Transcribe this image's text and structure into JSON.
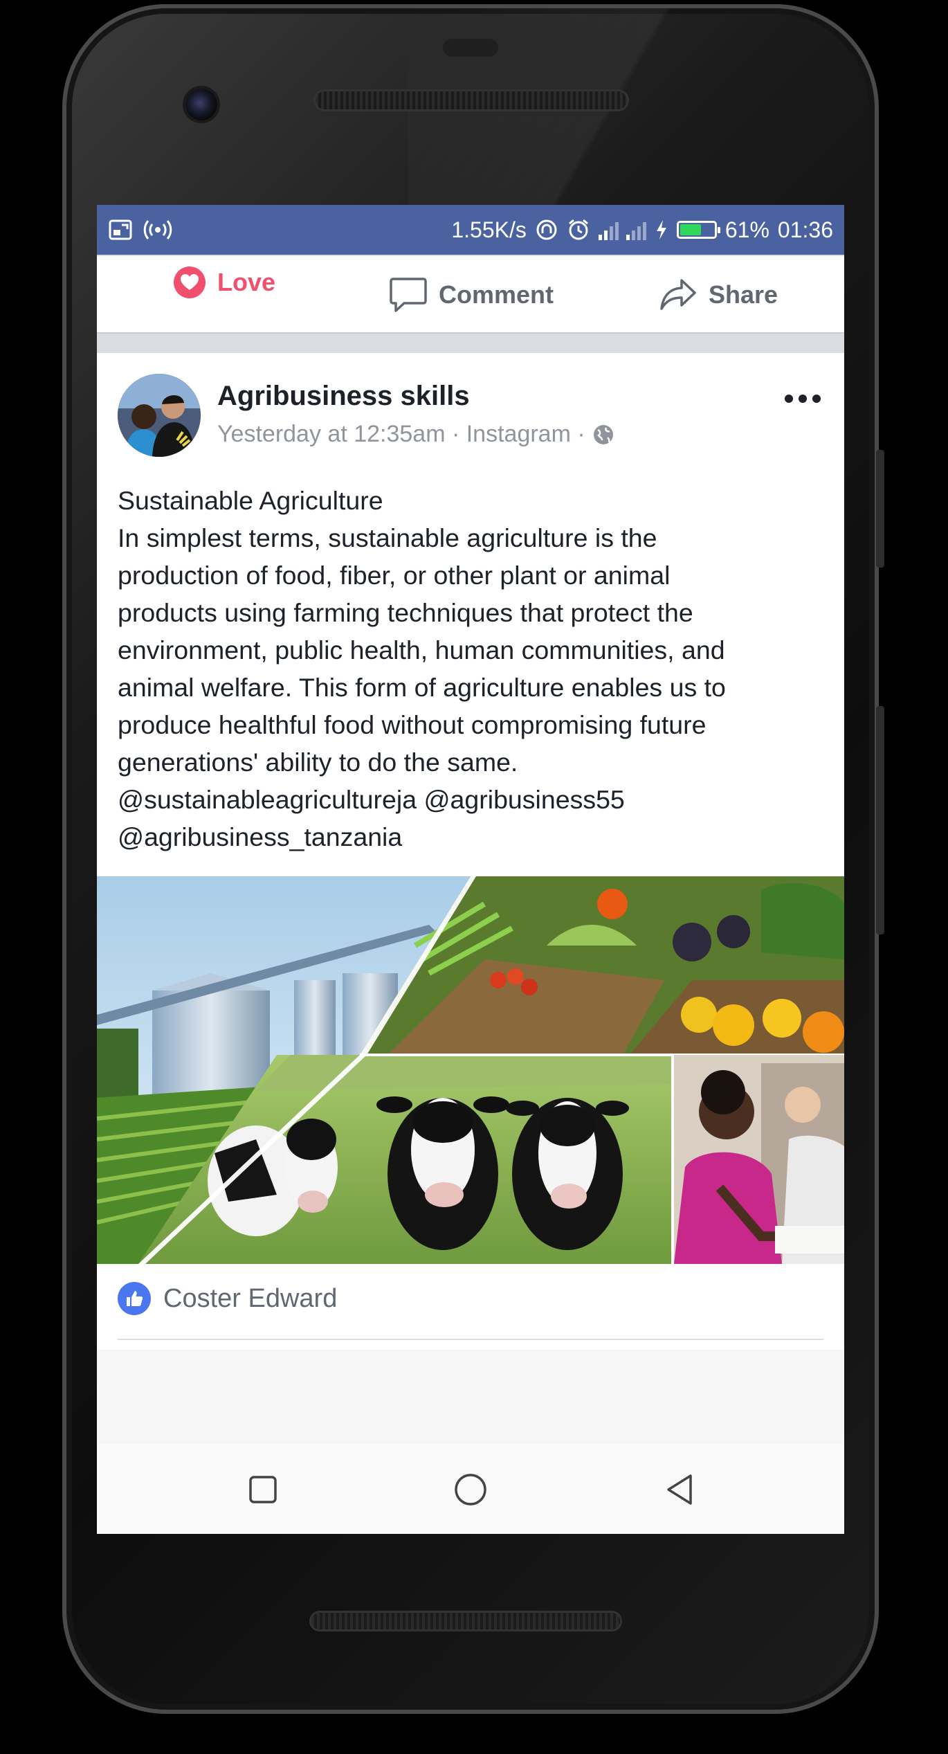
{
  "status_bar": {
    "speed": "1.55K/s",
    "battery_percent": "61%",
    "time": "01:36",
    "battery_level": 0.61,
    "battery_color": "#31d65a",
    "bar_color": "#4a62a0",
    "icons": [
      "screenshot-icon",
      "hotspot-icon",
      "data-saver-icon",
      "alarm-icon",
      "signal-icon",
      "charging-icon",
      "battery-icon"
    ]
  },
  "actions": {
    "love": "Love",
    "comment": "Comment",
    "share": "Share",
    "love_color": "#f0506e"
  },
  "post": {
    "author": "Agribusiness skills",
    "meta": "Yesterday at 12:35am · Instagram ·",
    "lines": [
      "Sustainable Agriculture",
      "In simplest terms, sustainable agriculture is the",
      "production of food, fiber, or other plant or animal",
      "products using farming techniques that protect the",
      "environment, public health, human communities, and",
      "animal welfare. This form of agriculture enables us to",
      "produce healthful food without compromising future",
      "generations' ability to do the same.",
      "@sustainableagricultureja @agribusiness55",
      "@agribusiness_tanzania"
    ],
    "reactor": "Coster Edward",
    "like_color": "#4a76f0"
  }
}
